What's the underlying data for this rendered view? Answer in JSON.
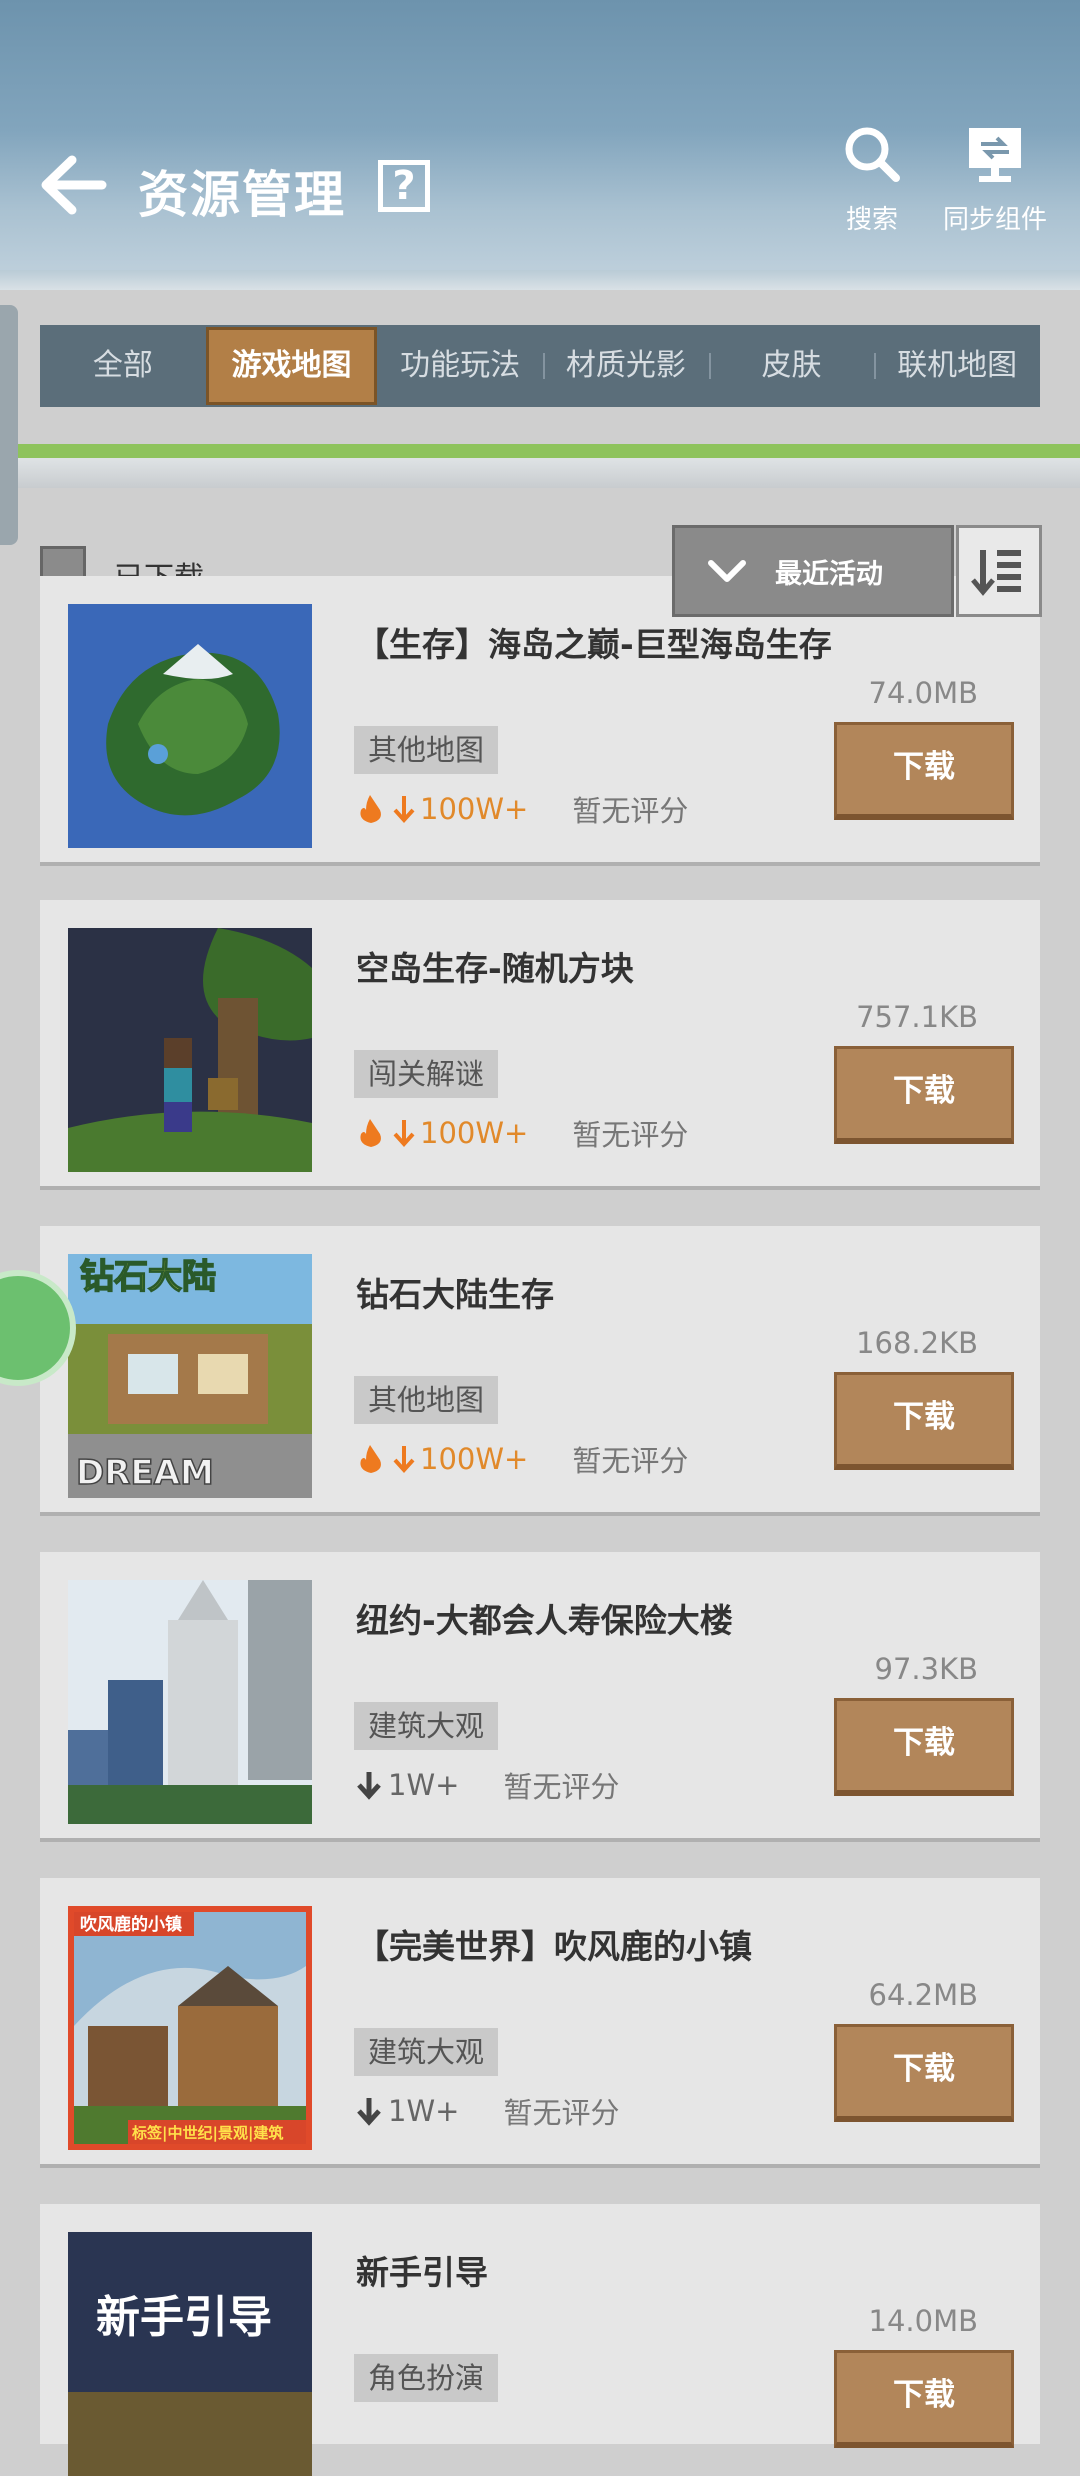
{
  "header": {
    "title": "资源管理",
    "help": "?",
    "search_label": "搜索",
    "sync_label": "同步组件"
  },
  "tabs": [
    {
      "label": "全部"
    },
    {
      "label": "游戏地图"
    },
    {
      "label": "功能玩法"
    },
    {
      "label": "材质光影"
    },
    {
      "label": "皮肤"
    },
    {
      "label": "联机地图"
    }
  ],
  "active_tab": "游戏地图",
  "filter": {
    "downloaded_label": "已下载",
    "sort_label": "最近活动"
  },
  "items": [
    {
      "name": "【生存】海岛之巅-巨型海岛生存",
      "size": "74.0MB",
      "tag": "其他地图",
      "downloads": "100W+",
      "rating": "暂无评分",
      "button": "下载"
    },
    {
      "name": "空岛生存-随机方块",
      "size": "757.1KB",
      "tag": "闯关解谜",
      "downloads": "100W+",
      "rating": "暂无评分",
      "button": "下载"
    },
    {
      "name": "钻石大陆生存",
      "size": "168.2KB",
      "tag": "其他地图",
      "downloads": "100W+",
      "rating": "暂无评分",
      "button": "下载",
      "thumb_title": "钻石大陆",
      "thumb_footer": "DREAM"
    },
    {
      "name": "纽约-大都会人寿保险大楼",
      "size": "97.3KB",
      "tag": "建筑大观",
      "downloads": "1W+",
      "rating": "暂无评分",
      "button": "下载"
    },
    {
      "name": "【完美世界】吹风鹿的小镇",
      "size": "64.2MB",
      "tag": "建筑大观",
      "downloads": "1W+",
      "rating": "暂无评分",
      "button": "下载",
      "thumb_title": "吹风鹿的小镇",
      "thumb_footer": "标签|中世纪|景观|建筑"
    },
    {
      "name": "新手引导",
      "size": "14.0MB",
      "tag": "角色扮演",
      "downloads": "",
      "rating": "",
      "button": "下载",
      "thumb_title": "新手引导"
    }
  ],
  "colors": {
    "accent": "#b2865a",
    "tab_active": "#b27f47",
    "hot_downloads": "#e1892a",
    "green_strip": "#8ec35c"
  }
}
